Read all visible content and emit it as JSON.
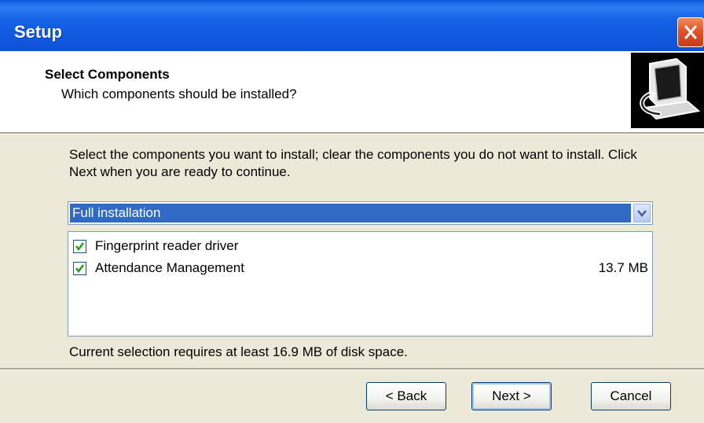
{
  "window": {
    "title": "Setup"
  },
  "header": {
    "title": "Select Components",
    "subtitle": "Which components should be installed?"
  },
  "instructions": "Select the components you want to install; clear the components you do not want to install. Click Next when you are ready to continue.",
  "install_type": {
    "selected": "Full installation"
  },
  "components": [
    {
      "label": "Fingerprint reader driver",
      "checked": true,
      "size": ""
    },
    {
      "label": "Attendance Management",
      "checked": true,
      "size": "13.7 MB"
    }
  ],
  "disk_space_text": "Current selection requires at least 16.9 MB of disk space.",
  "buttons": {
    "back": "< Back",
    "next": "Next >",
    "cancel": "Cancel"
  },
  "icons": {
    "close": "close-icon",
    "dropdown": "chevron-down-icon",
    "check": "check-icon",
    "setup_image": "computer-install-icon"
  },
  "colors": {
    "title_bar": "#0f55db",
    "selection": "#316ac5",
    "dialog_bg": "#ece9d8",
    "close_button": "#e0532a",
    "checkmark": "#21a121"
  }
}
